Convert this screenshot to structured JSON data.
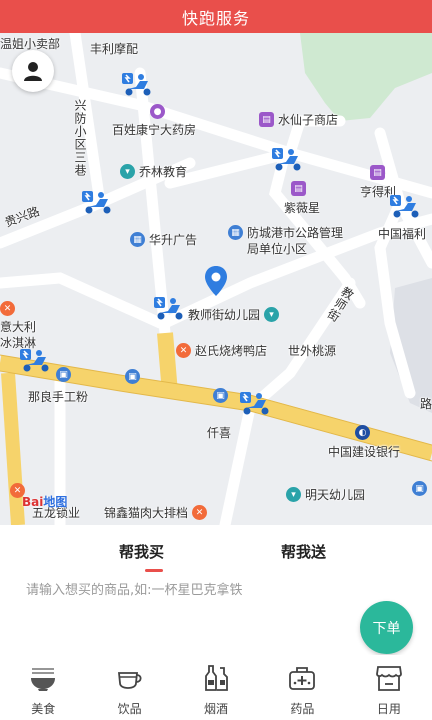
{
  "header": {
    "title": "快跑服务"
  },
  "map": {
    "pois": {
      "wenjie": "温姐小卖部",
      "fengli": "丰利摩配",
      "baixing": "百姓康宁大药房",
      "shuixian": "水仙子商店",
      "qiaolin": "乔林教育",
      "hengdeli": "亨得利",
      "ziwei": "紫薇星",
      "zhongguofuli": "中国福利",
      "huasheng": "华升广告",
      "fangcheng": "防城港市公路管理局单位小区",
      "jiaoshi": "教师街幼儿园",
      "zhaoshi": "赵氏烧烤鸭店",
      "shiwai": "世外桃源",
      "yidali": "意大利冰淇淋",
      "naliang": "那良手工粉",
      "qianxi": "仟喜",
      "jianshe": "中国建设银行",
      "mingtian": "明天幼儿园",
      "wulong": "五龙锁业",
      "jinxin": "锦鑫猫肉大排档"
    },
    "streets": {
      "xingfang": "兴防小区三巷",
      "guixing": "贵兴路",
      "jiaoshijie": "教师街",
      "lu": "路"
    },
    "baidu": {
      "bai": "Bai",
      "du": "地图"
    }
  },
  "tabs": {
    "buy": "帮我买",
    "send": "帮我送"
  },
  "search": {
    "placeholder": "请输入想买的商品,如:一杯星巴克拿铁"
  },
  "order_button": "下单",
  "nav": [
    {
      "label": "美食",
      "icon": "noodle-bowl-icon"
    },
    {
      "label": "饮品",
      "icon": "cup-icon"
    },
    {
      "label": "烟酒",
      "icon": "bottles-icon"
    },
    {
      "label": "药品",
      "icon": "medicine-box-icon"
    },
    {
      "label": "日用",
      "icon": "shop-icon"
    }
  ],
  "colors": {
    "accent": "#e94f4b",
    "order_button": "#2bb89b",
    "road_main": "#f6d36b",
    "courier": "#2f7de0"
  }
}
